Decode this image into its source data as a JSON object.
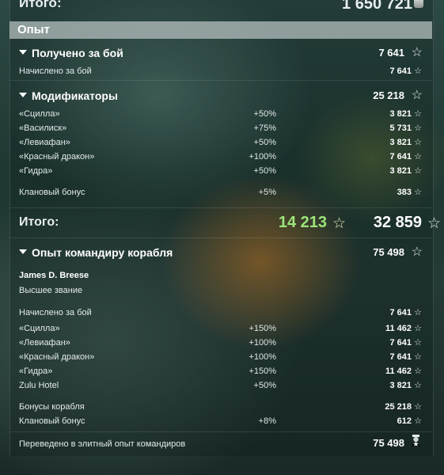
{
  "top_total": {
    "label": "Итого:",
    "value": "1 650 721"
  },
  "section_band": "Опыт",
  "earned": {
    "title": "Получено за бой",
    "total": "7 641",
    "row_label": "Начислено за бой",
    "row_value": "7 641"
  },
  "modifiers": {
    "title": "Модификаторы",
    "total": "25 218",
    "items": [
      {
        "name": "«Сцилла»",
        "pct": "+50%",
        "value": "3 821"
      },
      {
        "name": "«Василиск»",
        "pct": "+75%",
        "value": "5 731"
      },
      {
        "name": "«Левиафан»",
        "pct": "+50%",
        "value": "3 821"
      },
      {
        "name": "«Красный дракон»",
        "pct": "+100%",
        "value": "7 641"
      },
      {
        "name": "«Гидра»",
        "pct": "+50%",
        "value": "3 821"
      }
    ],
    "clan": {
      "name": "Клановый бонус",
      "pct": "+5%",
      "value": "383"
    }
  },
  "total": {
    "label": "Итого:",
    "base": "14 213",
    "full": "32 859"
  },
  "commander": {
    "title": "Опыт командиру корабля",
    "total": "75 498",
    "name": "James D. Breese",
    "rank": "Высшее звание",
    "earned_label": "Начислено за бой",
    "earned_value": "7 641",
    "items": [
      {
        "name": "«Сцилла»",
        "pct": "+150%",
        "value": "11 462"
      },
      {
        "name": "«Левиафан»",
        "pct": "+100%",
        "value": "7 641"
      },
      {
        "name": "«Красный дракон»",
        "pct": "+100%",
        "value": "7 641"
      },
      {
        "name": "«Гидра»",
        "pct": "+150%",
        "value": "11 462"
      },
      {
        "name": "Zulu Hotel",
        "pct": "+50%",
        "value": "3 821"
      }
    ],
    "ship_bonus": {
      "name": "Бонусы корабля",
      "value": "25 218"
    },
    "clan": {
      "name": "Клановый бонус",
      "pct": "+8%",
      "value": "612"
    },
    "elite": {
      "name": "Переведено в элитный опыт командиров",
      "value": "75 498"
    }
  },
  "icons": {
    "star": "star-icon",
    "coin": "credits-icon",
    "elite": "commander-icon"
  }
}
